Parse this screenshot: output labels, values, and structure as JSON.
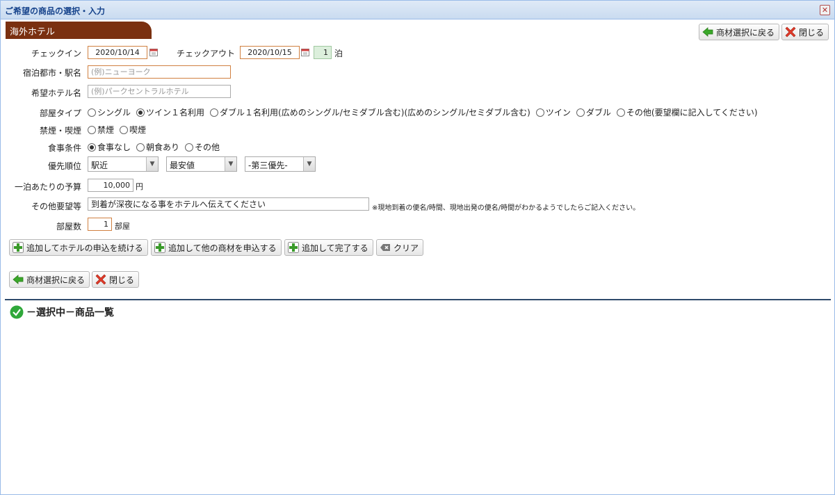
{
  "window": {
    "title": "ご希望の商品の選択・入力"
  },
  "section": {
    "tab_label": "海外ホテル"
  },
  "toolbar": {
    "back_label": "商材選択に戻る",
    "close_label": "閉じる"
  },
  "form": {
    "checkin_label": "チェックイン",
    "checkin_value": "2020/10/14",
    "checkout_label": "チェックアウト",
    "checkout_value": "2020/10/15",
    "nights_value": "1",
    "nights_unit": "泊",
    "city_label": "宿泊都市・駅名",
    "city_placeholder": "(例)ニューヨーク",
    "hotel_label": "希望ホテル名",
    "hotel_placeholder": "(例)パークセントラルホテル",
    "room_type_label": "部屋タイプ",
    "room_types": [
      "シングル",
      "ツイン１名利用",
      "ダブル１名利用(広めのシングル/セミダブル含む)(広めのシングル/セミダブル含む)",
      "ツイン",
      "ダブル",
      "その他(要望欄に記入してください)"
    ],
    "smoking_label": "禁煙・喫煙",
    "smoking_options": [
      "禁煙",
      "喫煙"
    ],
    "meal_label": "食事条件",
    "meal_options": [
      "食事なし",
      "朝食あり",
      "その他"
    ],
    "priority_label": "優先順位",
    "priority_1": "駅近",
    "priority_2": "最安値",
    "priority_3": "-第三優先-",
    "budget_label": "一泊あたりの予算",
    "budget_value": "10,000",
    "budget_unit": "円",
    "request_label": "その他要望等",
    "request_value": "到着が深夜になる事をホテルへ伝えてください",
    "request_note": "※現地到着の便名/時間、現地出発の便名/時間がわかるようでしたらご記入ください。",
    "rooms_label": "部屋数",
    "rooms_value": "1",
    "rooms_unit": "部屋"
  },
  "actions": {
    "continue_hotel": "追加してホテルの申込を続ける",
    "other_product": "追加して他の商材を申込する",
    "complete": "追加して完了する",
    "clear": "クリア"
  },
  "list": {
    "title": "－選択中－商品一覧"
  },
  "colors": {
    "tab_brown": "#7a3010",
    "plus_green": "#3a9a2a",
    "divider_navy": "#2e4a6b"
  }
}
